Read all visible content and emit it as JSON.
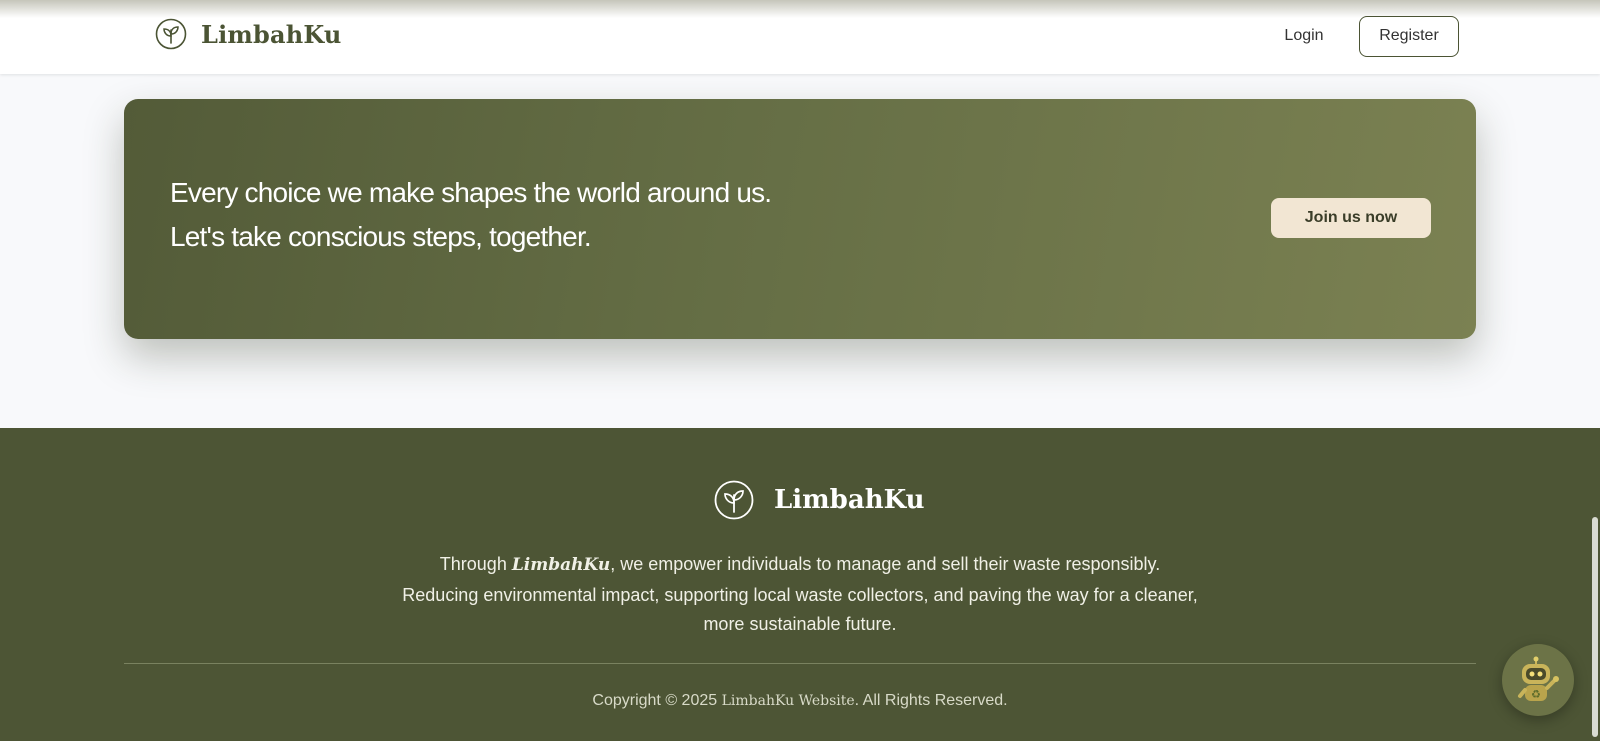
{
  "header": {
    "brand_name": "LimbahKu",
    "brand_icon": "sprout-icon",
    "login_label": "Login",
    "register_label": "Register"
  },
  "cta": {
    "line1": "Every choice we make shapes the world around us.",
    "line2": "Let's take conscious steps, together.",
    "button_label": "Join us now"
  },
  "footer": {
    "brand_name": "LimbahKu",
    "brand_icon": "sprout-icon",
    "desc_prefix": "Through ",
    "desc_brand": "LimbahKu",
    "desc_rest": ", we empower individuals to manage and sell their waste responsibly. Reducing environmental impact, supporting local waste collectors, and paving the way for a cleaner, more sustainable future.",
    "copyright_prefix": "Copyright © 2025 ",
    "copyright_site": "LimbahKu Website",
    "copyright_suffix": ". All Rights Reserved."
  },
  "chatbot": {
    "icon": "recycling-robot-icon"
  },
  "colors": {
    "brand_green": "#4d5535",
    "cta_gradient_start": "#535b38",
    "cta_gradient_end": "#7b8152",
    "cta_button_bg": "#f2e6d3",
    "page_bg": "#f8f9fb"
  }
}
